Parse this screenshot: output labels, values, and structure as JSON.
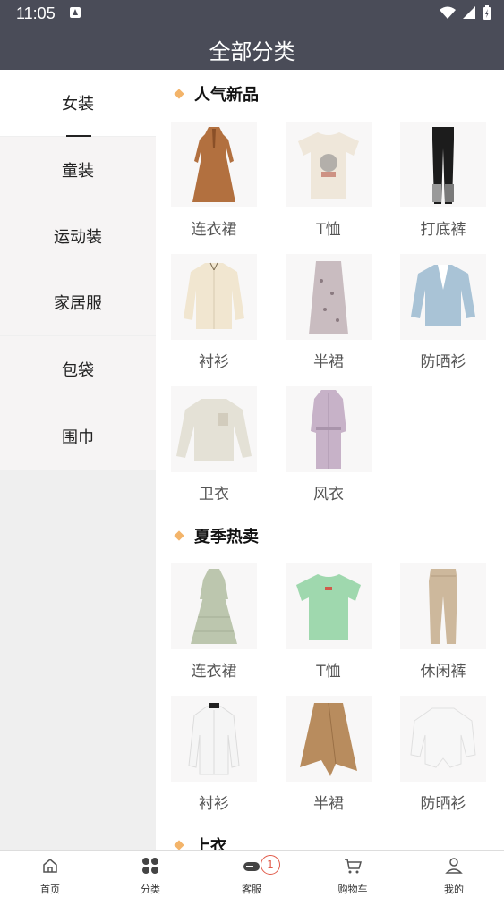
{
  "status_bar": {
    "time": "11:05"
  },
  "header": {
    "title": "全部分类"
  },
  "sidebar": {
    "items": [
      {
        "label": "女装"
      },
      {
        "label": "童装"
      },
      {
        "label": "运动装"
      },
      {
        "label": "家居服"
      },
      {
        "label": "包袋"
      },
      {
        "label": "围巾"
      }
    ]
  },
  "sections": [
    {
      "title": "人气新品",
      "items": [
        {
          "label": "连衣裙",
          "icon": "brown-dress-image"
        },
        {
          "label": "T恤",
          "icon": "cream-tshirt-image"
        },
        {
          "label": "打底裤",
          "icon": "black-leggings-image"
        },
        {
          "label": "衬衫",
          "icon": "cream-blouse-image"
        },
        {
          "label": "半裙",
          "icon": "floral-skirt-image"
        },
        {
          "label": "防晒衫",
          "icon": "blue-cardigan-image"
        },
        {
          "label": "卫衣",
          "icon": "sweatshirt-image"
        },
        {
          "label": "风衣",
          "icon": "lilac-trench-coat-image"
        }
      ]
    },
    {
      "title": "夏季热卖",
      "items": [
        {
          "label": "连衣裙",
          "icon": "sage-dress-image"
        },
        {
          "label": "T恤",
          "icon": "green-tshirt-image"
        },
        {
          "label": "休闲裤",
          "icon": "khaki-pants-image"
        },
        {
          "label": "衬衫",
          "icon": "white-shirt-image"
        },
        {
          "label": "半裙",
          "icon": "camel-skirt-image"
        },
        {
          "label": "防晒衫",
          "icon": "white-cover-up-image"
        }
      ]
    },
    {
      "title": "上衣",
      "items": []
    }
  ],
  "tabbar": {
    "items": [
      {
        "label": "首页"
      },
      {
        "label": "分类"
      },
      {
        "label": "客服",
        "badge": "1"
      },
      {
        "label": "购物车"
      },
      {
        "label": "我的"
      }
    ]
  },
  "colors": {
    "header_bg": "#4a4c58",
    "accent_diamond": "#f3b46a",
    "badge": "#e15b4a"
  }
}
